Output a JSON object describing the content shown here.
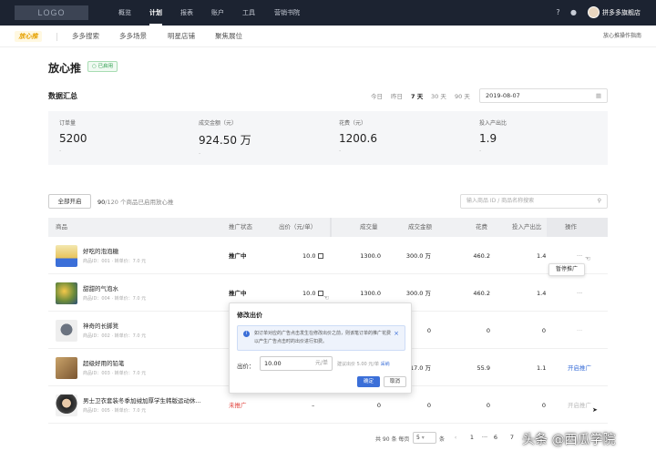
{
  "topbar": {
    "logo": "LOGO",
    "nav": [
      "概览",
      "计划",
      "报表",
      "账户",
      "工具",
      "营销书院"
    ],
    "active_nav": "计划",
    "shop_name": "拼多多旗舰店"
  },
  "subbar": {
    "brand": "放心推",
    "tabs": [
      "多多搜索",
      "多多场景",
      "明星店铺",
      "聚焦展位"
    ],
    "guide": "放心推操作指南"
  },
  "page": {
    "title": "放心推",
    "status_badge": "已启用"
  },
  "summary": {
    "title": "数据汇总",
    "ranges": [
      "今日",
      "昨日",
      "7 天",
      "30 天",
      "90 天"
    ],
    "active_range": "7 天",
    "date": "2019-08-07",
    "stats": [
      {
        "label": "订单量",
        "value": "5200",
        "sub": "-"
      },
      {
        "label": "成交金额（元）",
        "value": "924.50 万",
        "sub": "-"
      },
      {
        "label": "花费（元）",
        "value": "1200.6",
        "sub": "-"
      },
      {
        "label": "投入产出比",
        "value": "1.9",
        "sub": "-"
      }
    ]
  },
  "toolbar": {
    "enable_all": "全部开启",
    "count_prefix": "90",
    "count_rest": "/120 个商品已启用放心推",
    "search_placeholder": "输入商品 ID / 商品名称搜索"
  },
  "table": {
    "headers": [
      "商品",
      "推广状态",
      "出价（元/单）",
      "成交量",
      "成交金额",
      "花费",
      "投入产出比",
      "操作"
    ],
    "rows": [
      {
        "name": "好吃的泡泡糖",
        "meta": "商品ID：001 · 转单价：7.0 元",
        "status": "推广中",
        "status_type": "on",
        "bid": "10.0",
        "volume": "1300.0",
        "amount": "300.0 万",
        "cost": "460.2",
        "roi": "1.4",
        "op": "···",
        "op_type": "more"
      },
      {
        "name": "甜甜的气泡水",
        "meta": "商品ID：004 · 转单价：7.0 元",
        "status": "推广中",
        "status_type": "on",
        "bid": "10.0",
        "volume": "1300.0",
        "amount": "300.0 万",
        "cost": "460.2",
        "roi": "1.4",
        "op": "···",
        "op_type": "more"
      },
      {
        "name": "神奇的长脚凳",
        "meta": "商品ID：002 · 转单价：7.0 元",
        "status": "",
        "status_type": "none",
        "bid": "",
        "volume": "",
        "amount": "0",
        "cost": "0",
        "roi": "0",
        "op": "···",
        "op_type": "gray"
      },
      {
        "name": "超级好用的铅笔",
        "meta": "商品ID：003 · 转单价：7.0 元",
        "status": "",
        "status_type": "none",
        "bid": "",
        "volume": "",
        "amount": "17.0 万",
        "cost": "55.9",
        "roi": "1.1",
        "op": "开启推广",
        "op_type": "blue"
      },
      {
        "name": "男士卫衣套装冬季加绒加厚学生韩版运动休...",
        "meta": "商品ID：005 · 转单价：7.0 元",
        "status": "未推广",
        "status_type": "off",
        "bid": "–",
        "volume": "0",
        "amount": "0",
        "cost": "0",
        "roi": "0",
        "op": "开启推广",
        "op_type": "gray"
      }
    ]
  },
  "tooltip": {
    "text": "暂停推广"
  },
  "popup": {
    "title": "修改出价",
    "info": "如订单对应的广告点击发生在修改出价之前，则该笔订单的推广花费以产生广告点击时的出价进行扣费。",
    "price_label": "出价：",
    "price_value": "10.00",
    "price_unit": "元/单",
    "hint_text": "建议出价 5.00 元/单",
    "hint_link": "采纳",
    "ok": "确定",
    "cancel": "取消"
  },
  "pager": {
    "total": "共 90 条 每页",
    "page_size": "5",
    "per": "条",
    "prev": "‹",
    "pages": [
      "1",
      "···",
      "6",
      "7"
    ]
  },
  "watermark": "头条 @西瓜学院",
  "colors": {
    "topbar": "#1c2331",
    "accent_blue": "#3b6fd8",
    "status_green": "#2f9e4f",
    "status_red": "#e0403a"
  }
}
